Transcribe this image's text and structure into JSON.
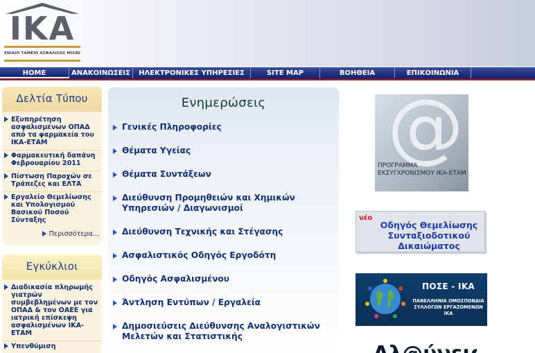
{
  "logo": {
    "letters": "ΙΚΑ",
    "subtitle": "ΕΝΙΑΙΟ ΤΑΜΕΙΟ ΑΣΦΑΛΙΣΗΣ ΜΙΣΘΩΤΩΝ"
  },
  "nav": {
    "items": [
      {
        "label": "HOME"
      },
      {
        "label": "ΑΝΑΚΟΙΝΩΣΕΙΣ"
      },
      {
        "label": "ΗΛΕΚΤΡΟΝΙΚΕΣ ΥΠΗΡΕΣΙΕΣ"
      },
      {
        "label": "SITE MAP"
      },
      {
        "label": "ΒΟΗΘΕΙΑ"
      },
      {
        "label": "ΕΠΙΚΟΙΝΩΝΙΑ"
      }
    ]
  },
  "press": {
    "title": "Δελτία Τύπου",
    "items": [
      {
        "label": "Εξυπηρέτηση ασφαλισμένων ΟΠΑΔ από τα φαρμακεία του ΙΚΑ-ΕΤΑΜ"
      },
      {
        "label": "Φαρμακευτική δαπάνη Φεβρουαρίου 2011"
      },
      {
        "label": "Πίστωση Παροχών σε Τράπεζες και ΕΛΤΑ"
      },
      {
        "label": "Εργαλείο Θεμελίωσης και Υπολογισμού Βασικού Ποσού Σύνταξης"
      }
    ],
    "more": "Περισσότερα..."
  },
  "circulars": {
    "title": "Εγκύκλιοι",
    "items": [
      {
        "label": "Διαδικασία πληρωμής γιατρών συμβεβλημένων με τον ΟΠΑΔ & τον ΟΑΕΕ για ιατρική επίσκεψη ασφαλισμένων ΙΚΑ-ΕΤΑΜ"
      },
      {
        "label": "Υπενθύμιση"
      }
    ]
  },
  "updates": {
    "title": "Ενημερώσεις",
    "items": [
      {
        "label": "Γενικές Πληροφορίες"
      },
      {
        "label": "Θέματα Υγείας"
      },
      {
        "label": "Θέματα Συντάξεων"
      },
      {
        "label": "Διεύθυνση Προμηθειών και Χημικών Υπηρεσιών / Διαγωνισμοί"
      },
      {
        "label": "Διεύθυνση Τεχνικής και Στέγασης"
      },
      {
        "label": "Ασφαλιστικός Οδηγός Εργοδότη"
      },
      {
        "label": "Οδηγός Ασφαλισμένου"
      },
      {
        "label": "Άντληση Εντύπων / Εργαλεία"
      },
      {
        "label": "Δημοσιεύσεις Διεύθυνσης Αναλογιστικών Μελετών και Στατιστικής"
      }
    ]
  },
  "banners": {
    "modernization": {
      "symbol": "@",
      "text": "ΠΡΟΓΡΑΜΜΑ ΕΚΣΥΓΧΡΟΝΙΣΜΟΥ ΙΚΑ-ΕΤΑΜ"
    },
    "guide": {
      "badge": "νέο",
      "text": "Οδηγός Θεμελίωσης Συνταξιοδοτικού Δικαιώματος"
    },
    "pose": {
      "title": "ΠΟΣΕ - ΙΚΑ",
      "subtitle": "ΠΑΝΕΛΛΗΝΙΑ ΟΜΟΣΠΟΝΔΙΑ ΣΥΛΛΟΓΩΝ ΕΡΓΑΖΟΜΕΝΩΝ ΙΚΑ"
    },
    "bottom": {
      "text": "Αλ@ύνεια"
    }
  },
  "colors": {
    "nav_bg": "#1f2f78",
    "nav_underline": "#a12020",
    "link": "#123070",
    "box_bg": "#fbf1df",
    "badge_new": "#d01010"
  }
}
